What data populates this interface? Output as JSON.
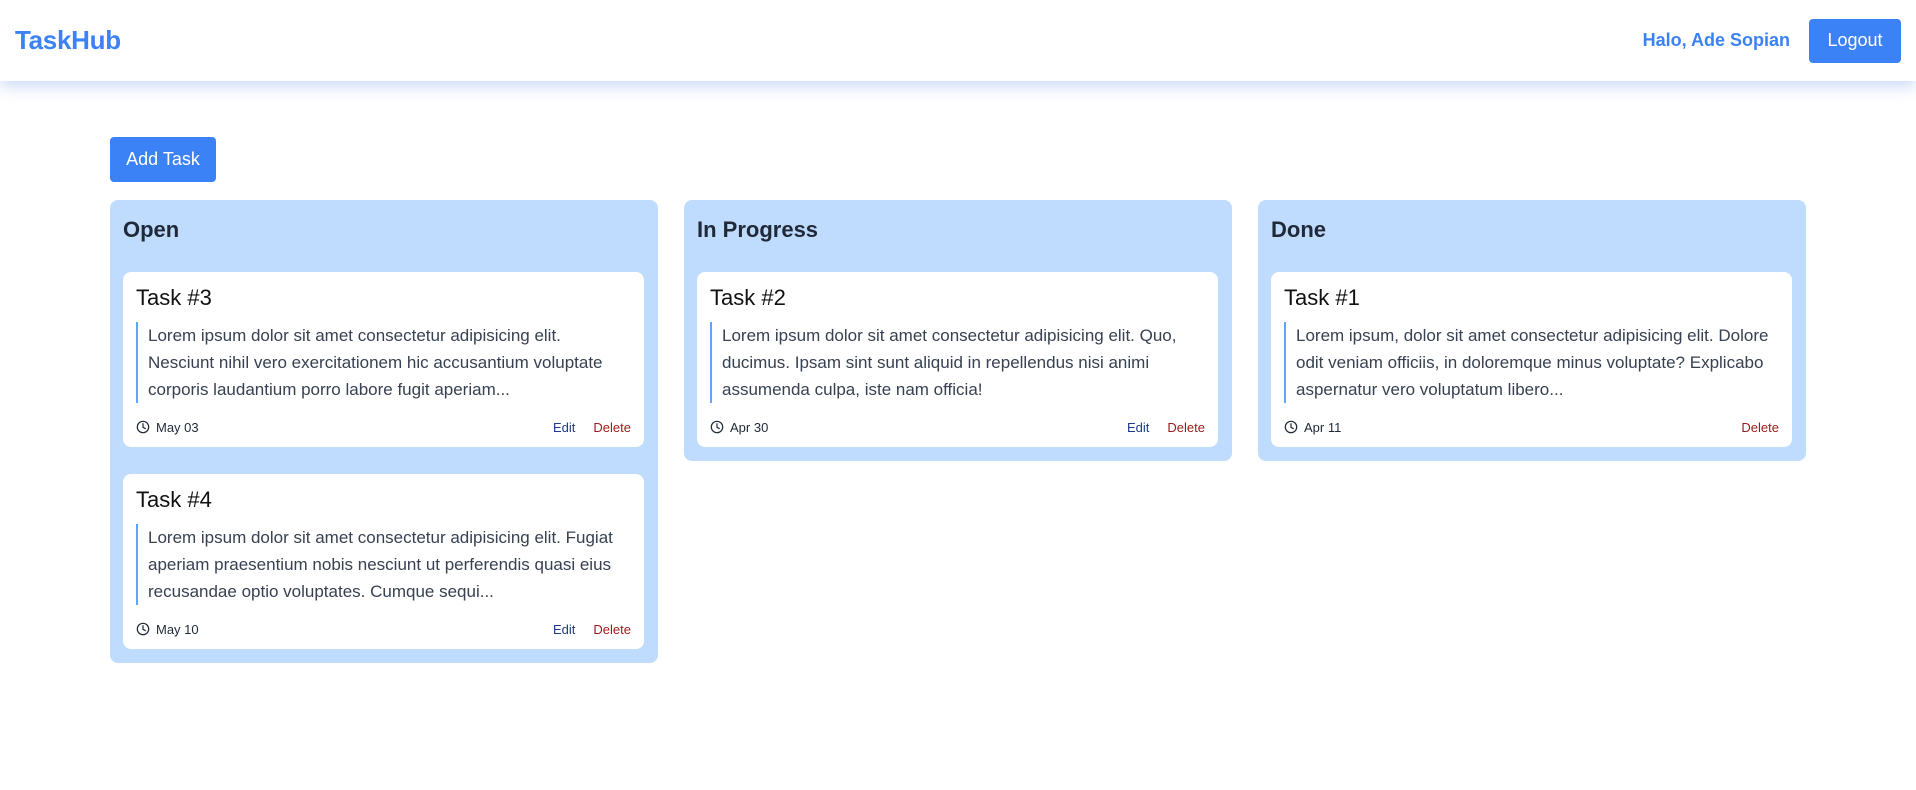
{
  "header": {
    "brand": "TaskHub",
    "greeting": "Halo, Ade Sopian",
    "logout_label": "Logout"
  },
  "toolbar": {
    "add_task_label": "Add Task"
  },
  "columns": [
    {
      "title": "Open",
      "cards": [
        {
          "title": "Task #3",
          "description": "Lorem ipsum dolor sit amet consectetur adipisicing elit. Nesciunt nihil vero exercitationem hic accusantium voluptate corporis laudantium porro labore fugit aperiam...",
          "date": "May 03",
          "edit_label": "Edit",
          "delete_label": "Delete"
        },
        {
          "title": "Task #4",
          "description": "Lorem ipsum dolor sit amet consectetur adipisicing elit. Fugiat aperiam praesentium nobis nesciunt ut perferendis quasi eius recusandae optio voluptates. Cumque sequi...",
          "date": "May 10",
          "edit_label": "Edit",
          "delete_label": "Delete"
        }
      ]
    },
    {
      "title": "In Progress",
      "cards": [
        {
          "title": "Task #2",
          "description": "Lorem ipsum dolor sit amet consectetur adipisicing elit. Quo, ducimus. Ipsam sint sunt aliquid in repellendus nisi animi assumenda culpa, iste nam officia!",
          "date": "Apr 30",
          "edit_label": "Edit",
          "delete_label": "Delete"
        }
      ]
    },
    {
      "title": "Done",
      "cards": [
        {
          "title": "Task #1",
          "description": "Lorem ipsum, dolor sit amet consectetur adipisicing elit. Dolore odit veniam officiis, in doloremque minus voluptate? Explicabo aspernatur vero voluptatum libero...",
          "date": "Apr 11",
          "delete_label": "Delete"
        }
      ]
    }
  ],
  "colors": {
    "accent": "#3b82f6",
    "column_bg": "#bfdbfe",
    "card_border": "#60a5fa",
    "edit": "#1e3a8a",
    "delete": "#991b1b"
  },
  "icons": {
    "date": "clock-icon"
  }
}
